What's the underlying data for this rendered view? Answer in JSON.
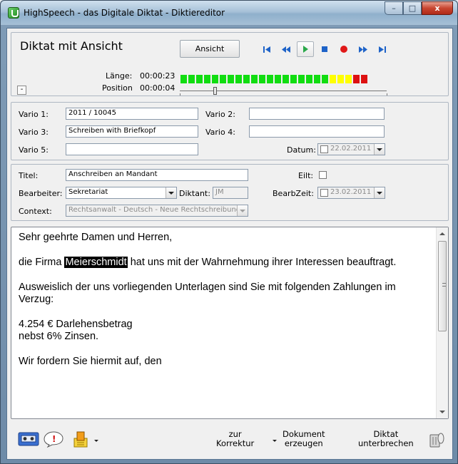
{
  "window": {
    "title": "HighSpeech - das Digitale Diktat  -  Diktiereditor",
    "minimize": "–",
    "maximize": "□",
    "close": "x"
  },
  "player": {
    "dictation_title": "Diktat mit Ansicht",
    "view_button": "Ansicht",
    "length_label": "Länge:",
    "length_value": "00:00:23",
    "position_label": "Position",
    "position_value": "00:00:04",
    "collapse_label": "-",
    "position_fraction": 0.17,
    "level_meter": {
      "segments_total": 24,
      "colors": [
        "#11dd11",
        "#11dd11",
        "#11dd11",
        "#11dd11",
        "#11dd11",
        "#11dd11",
        "#11dd11",
        "#11dd11",
        "#11dd11",
        "#11dd11",
        "#11dd11",
        "#11dd11",
        "#11dd11",
        "#11dd11",
        "#11dd11",
        "#11dd11",
        "#11dd11",
        "#11dd11",
        "#11dd11",
        "#ffff00",
        "#ffff00",
        "#ffff00",
        "#dd1111",
        "#dd1111"
      ]
    },
    "transport_icons": [
      "skip-start-icon",
      "rewind-icon",
      "play-icon",
      "stop-icon",
      "record-icon",
      "fast-forward-icon",
      "skip-end-icon"
    ]
  },
  "vario": {
    "vario1_label": "Vario 1:",
    "vario1_value": "2011 / 10045",
    "vario2_label": "Vario 2:",
    "vario2_value": "",
    "vario3_label": "Vario 3:",
    "vario3_value": "Schreiben with Briefkopf",
    "vario4_label": "Vario 4:",
    "vario4_value": "",
    "vario5_label": "Vario 5:",
    "vario5_value": "",
    "datum_label": "Datum:",
    "datum_value": "22.02.2011"
  },
  "meta": {
    "titel_label": "Titel:",
    "titel_value": "Anschreiben an Mandant",
    "eilt_label": "Eilt:",
    "bearbeiter_label": "Bearbeiter:",
    "bearbeiter_value": "Sekretariat",
    "diktant_label": "Diktant:",
    "diktant_value": "JM",
    "bearbzeit_label": "BearbZeit:",
    "bearbzeit_value": "23.02.2011",
    "context_label": "Context:",
    "context_value": "Rechtsanwalt - Deutsch - Neue Rechtschreibung -"
  },
  "document": {
    "line1": "Sehr geehrte Damen und Herren,",
    "line2_pre": "die Firma ",
    "line2_highlight": "Meierschmidt",
    "line2_post": " hat uns mit der Wahrnehmung ihrer Interessen beauftragt.",
    "line3": "Ausweislich der uns vorliegenden Unterlagen sind Sie mit folgenden Zahlungen im Verzug:",
    "line4a": "4.254 € Darlehensbetrag",
    "line4b": "nebst 6% Zinsen.",
    "line5": "Wir fordern Sie hiermit auf, den"
  },
  "toolbar": {
    "zur_korrektur_line1": "zur",
    "zur_korrektur_line2": "Korrektur",
    "dokument_line1": "Dokument",
    "dokument_line2": "erzeugen",
    "diktat_line1": "Diktat",
    "diktat_line2": "unterbrechen"
  }
}
